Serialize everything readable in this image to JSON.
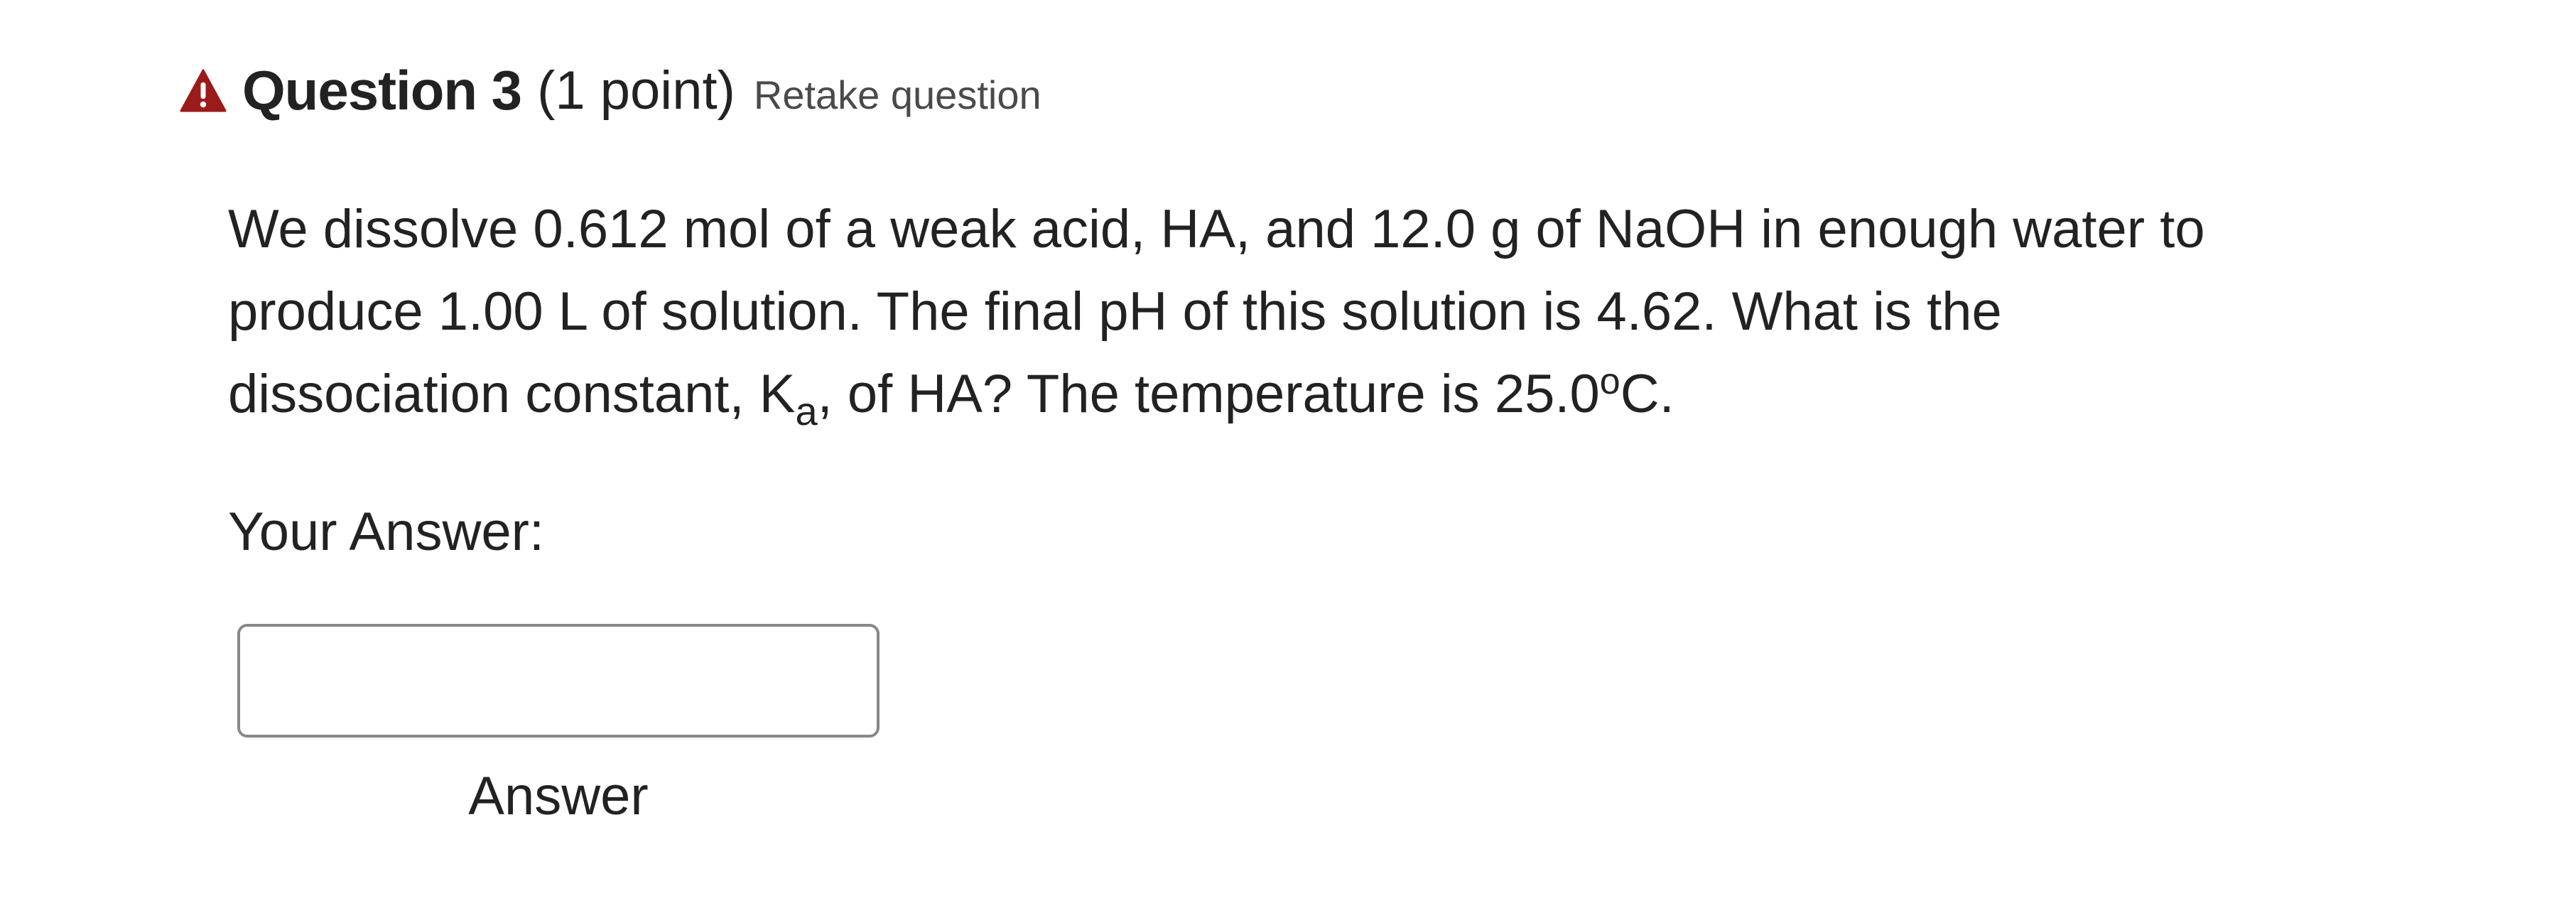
{
  "question": {
    "title": "Question 3",
    "points": "(1 point)",
    "retake_label": "Retake question",
    "text": {
      "line1": "We dissolve 0.612 mol of a weak acid, HA, and 12.0 g of NaOH in enough water to",
      "line2": "produce 1.00 L of solution. The final pH of this solution is 4.62.  What is the",
      "line3_prefix": "dissociation constant, K",
      "line3_sub": "a",
      "line3_middle": ", of HA?  The temperature is 25.0",
      "line3_sup": "o",
      "line3_suffix": "C."
    }
  },
  "answer": {
    "prompt": "Your Answer:",
    "value": "",
    "placeholder": "",
    "label": "Answer"
  },
  "icons": {
    "warning": "warning-triangle-icon"
  },
  "colors": {
    "warning": "#9b1b1b",
    "text": "#222222"
  }
}
